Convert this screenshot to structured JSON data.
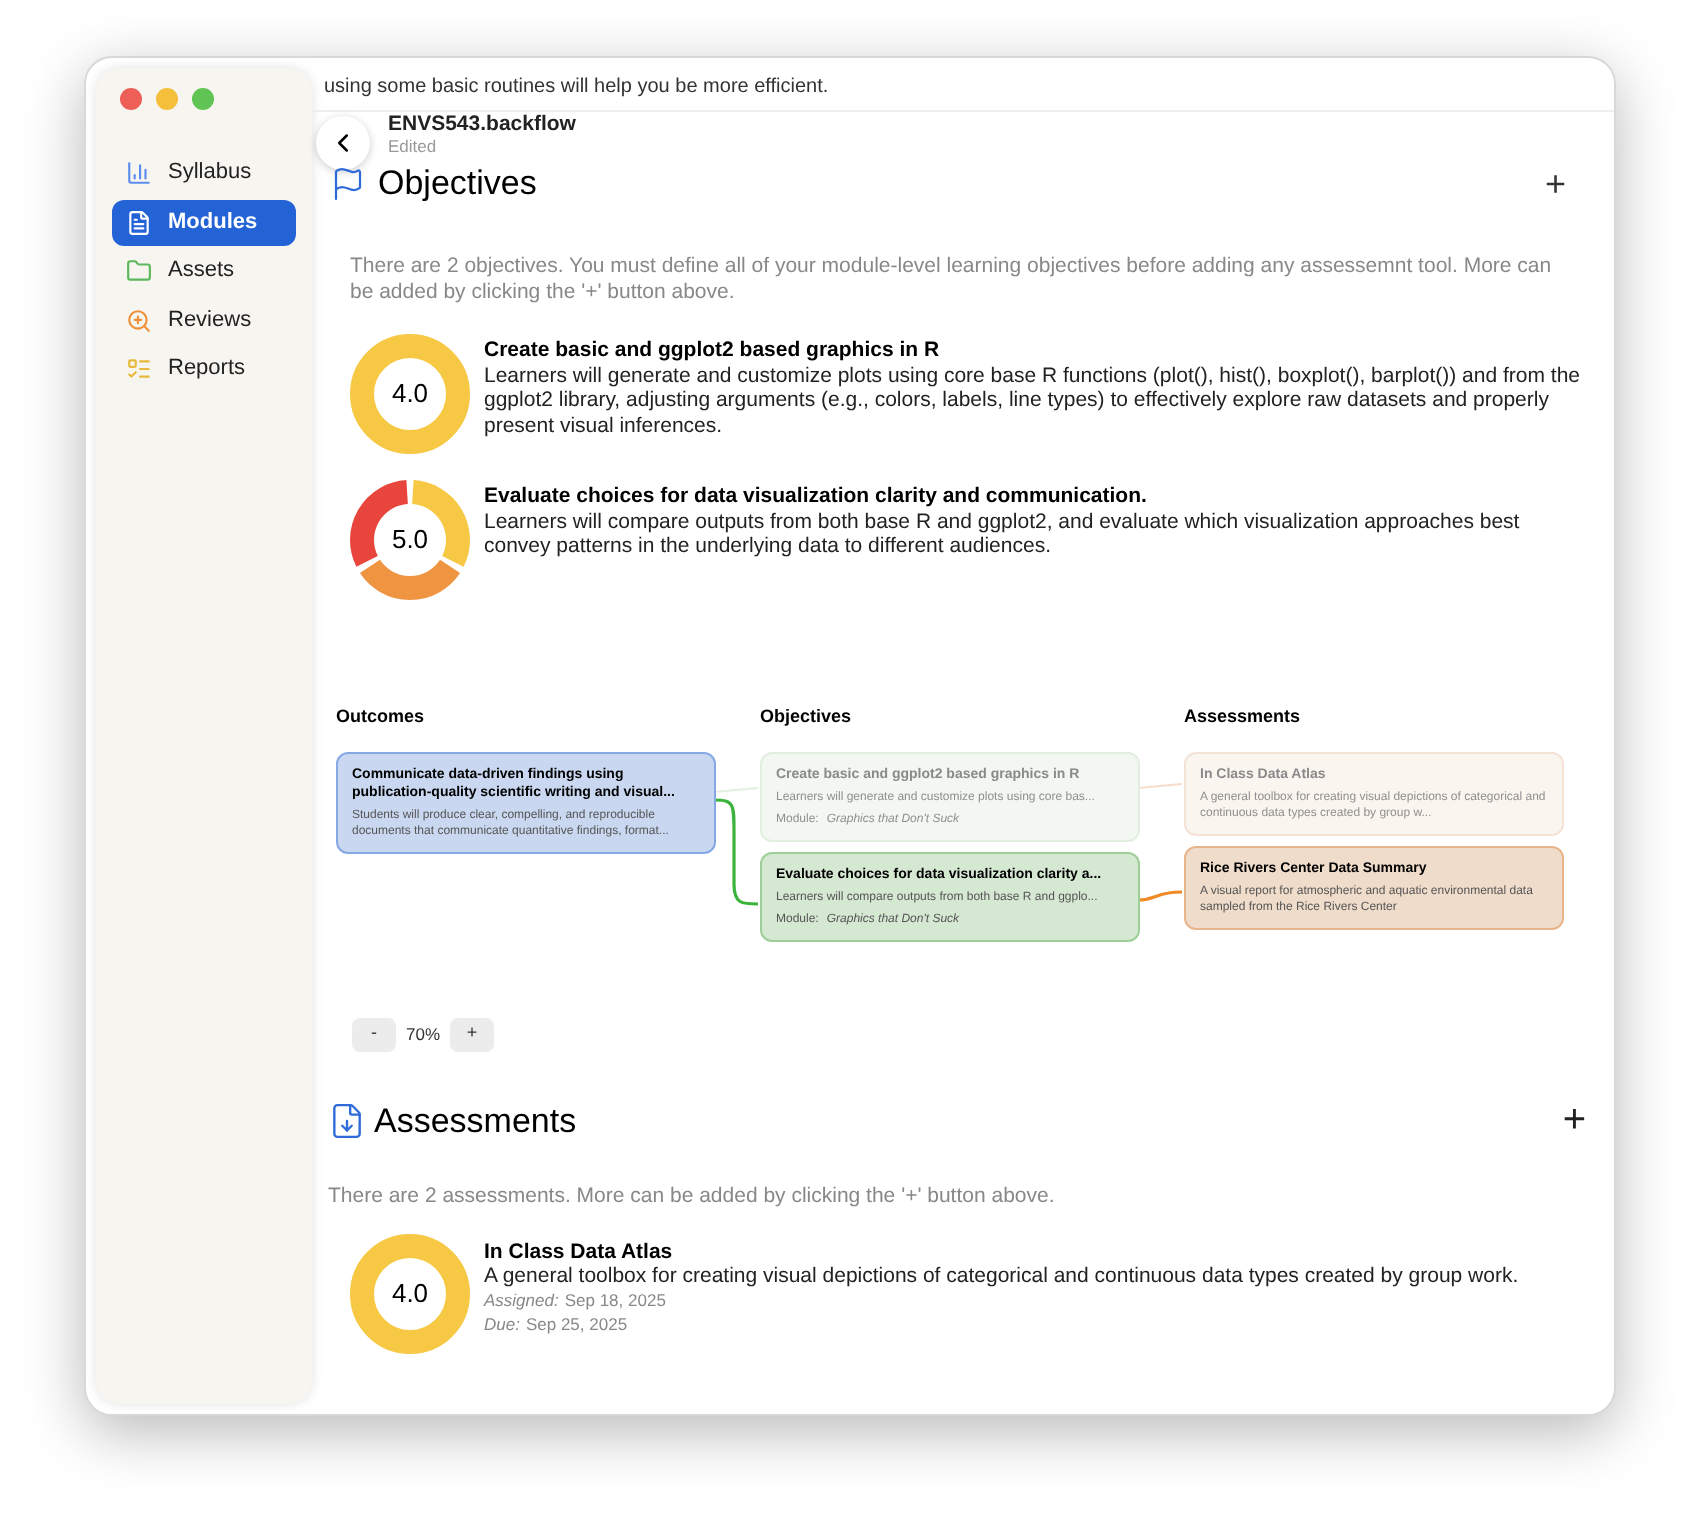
{
  "top_note": "using some basic routines will help you be more efficient.",
  "document": {
    "title": "ENVS543.backflow",
    "status": "Edited"
  },
  "sidebar": {
    "items": [
      {
        "label": "Syllabus",
        "selected": false
      },
      {
        "label": "Modules",
        "selected": true
      },
      {
        "label": "Assets",
        "selected": false
      },
      {
        "label": "Reviews",
        "selected": false
      },
      {
        "label": "Reports",
        "selected": false
      }
    ]
  },
  "objectives": {
    "title": "Objectives",
    "add_button": "+",
    "note": "There are 2 objectives.  You must define all of your module-level learning objectives before adding any assessemnt tool.  More can be added by clicking the '+' button above.",
    "items": [
      {
        "score": "4.0",
        "title": "Create basic and ggplot2 based graphics in R",
        "description": "Learners will generate and customize plots using core base R functions (plot(), hist(), boxplot(), barplot()) and from the ggplot2 library, adjusting arguments (e.g., colors, labels, line types) to effectively explore raw datasets and properly present visual inferences.",
        "segments": [
          {
            "color": "#f7c843"
          }
        ]
      },
      {
        "score": "5.0",
        "title": "Evaluate choices for data visualization clarity and communication.",
        "description": "Learners will compare outputs from both base R and ggplot2, and evaluate which visualization approaches best convey patterns in the underlying data to different audiences.",
        "segments": [
          {
            "color": "#f7c843"
          },
          {
            "color": "#ef9440"
          },
          {
            "color": "#e8453c"
          }
        ]
      }
    ]
  },
  "diagram": {
    "columns": [
      {
        "heading": "Outcomes",
        "nodes": [
          {
            "title": "Communicate data-driven findings using publication-quality scientific writing and visual...",
            "description": "Students will produce clear, compelling, and reproducible documents that communicate quantitative findings, format...",
            "highlighted": true
          }
        ]
      },
      {
        "heading": "Objectives",
        "nodes": [
          {
            "title": "Create basic and ggplot2 based graphics in R",
            "description": "Learners will generate and customize plots using core bas...",
            "module_label": "Module:",
            "module": "Graphics that Don't Suck",
            "highlighted": false
          },
          {
            "title": "Evaluate choices for data visualization clarity a...",
            "description": "Learners will compare outputs from both base R and ggplo...",
            "module_label": "Module:",
            "module": "Graphics that Don't Suck",
            "highlighted": true
          }
        ]
      },
      {
        "heading": "Assessments",
        "nodes": [
          {
            "title": "In Class Data Atlas",
            "description": "A general toolbox for creating visual depictions of categorical and continuous data types created by group w...",
            "highlighted": false
          },
          {
            "title": "Rice Rivers Center Data Summary",
            "description": "A visual report for atmospheric and aquatic environmental data sampled from the Rice Rivers Center",
            "highlighted": true
          }
        ]
      }
    ],
    "zoom_out": "-",
    "zoom": "70%",
    "zoom_in": "+"
  },
  "assessments": {
    "title": "Assessments",
    "add_button": "+",
    "note": "There are 2 assessments.  More can be added by clicking the '+' button above.",
    "items": [
      {
        "score": "4.0",
        "title": "In Class Data Atlas",
        "description": "A general toolbox for creating visual depictions of categorical and continuous data types created by group work.",
        "assigned_label": "Assigned:",
        "assigned": "Sep 18, 2025",
        "due_label": "Due:",
        "due": "Sep 25, 2025",
        "segments": [
          {
            "color": "#f7c843"
          }
        ]
      }
    ]
  }
}
